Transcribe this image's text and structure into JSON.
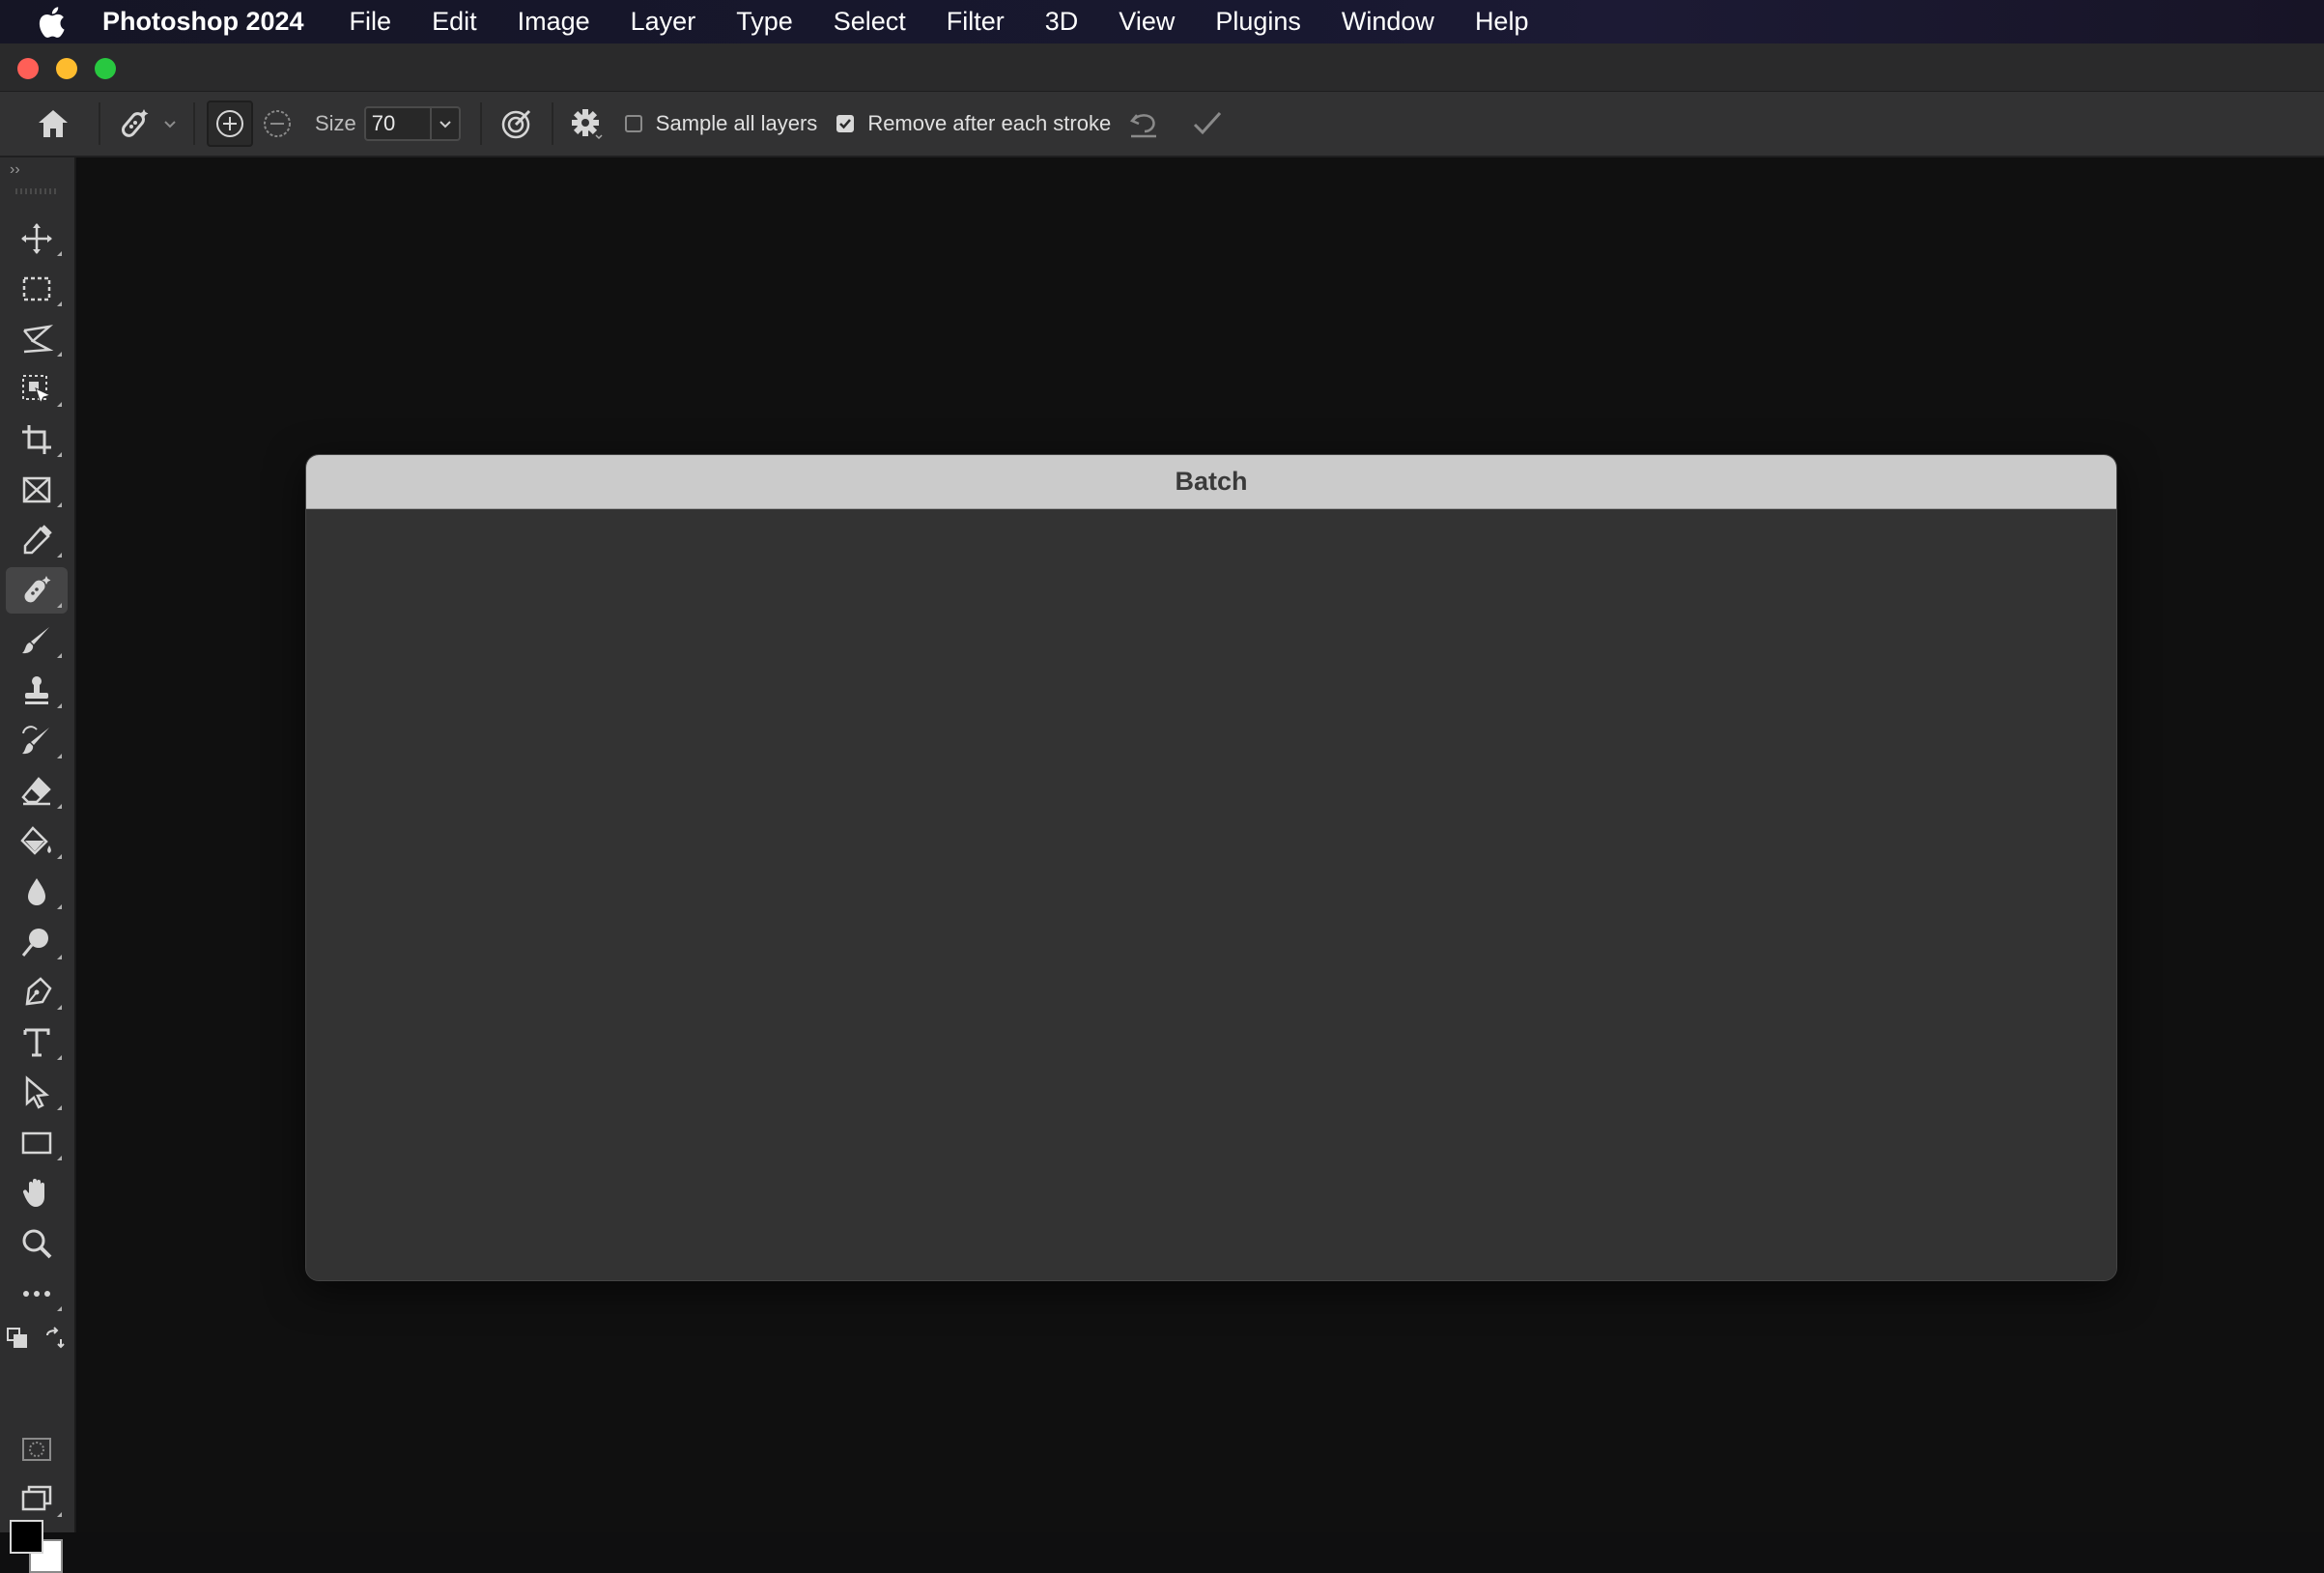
{
  "menubar": {
    "apple_icon": "apple-logo-icon",
    "app_name": "Photoshop 2024",
    "items": [
      {
        "id": "file",
        "label": "File"
      },
      {
        "id": "edit",
        "label": "Edit"
      },
      {
        "id": "image",
        "label": "Image"
      },
      {
        "id": "layer",
        "label": "Layer"
      },
      {
        "id": "type",
        "label": "Type"
      },
      {
        "id": "select",
        "label": "Select"
      },
      {
        "id": "filter",
        "label": "Filter"
      },
      {
        "id": "3d",
        "label": "3D"
      },
      {
        "id": "view",
        "label": "View"
      },
      {
        "id": "plugins",
        "label": "Plugins"
      },
      {
        "id": "window",
        "label": "Window"
      },
      {
        "id": "help",
        "label": "Help"
      }
    ]
  },
  "window": {
    "traffic_lights": {
      "close": "#ff5f57",
      "minimize": "#febc2e",
      "maximize": "#28c840"
    }
  },
  "options_bar": {
    "size_label": "Size",
    "size_value": "70",
    "sample_all_layers": {
      "label": "Sample all layers",
      "checked": false
    },
    "remove_after_stroke": {
      "label": "Remove after each stroke",
      "checked": true
    }
  },
  "tools": {
    "active": "remove-tool",
    "list": [
      "move",
      "rectangular-marquee",
      "lasso",
      "object-selection",
      "crop",
      "frame",
      "eyedropper",
      "remove",
      "brush",
      "clone-stamp",
      "history-brush",
      "eraser",
      "paint-bucket",
      "blur",
      "dodge",
      "pen",
      "type",
      "path-selection",
      "rectangle",
      "hand",
      "zoom",
      "edit-toolbar"
    ],
    "foreground_color": "#000000",
    "background_color": "#ffffff"
  },
  "dialog": {
    "title": "Batch"
  }
}
